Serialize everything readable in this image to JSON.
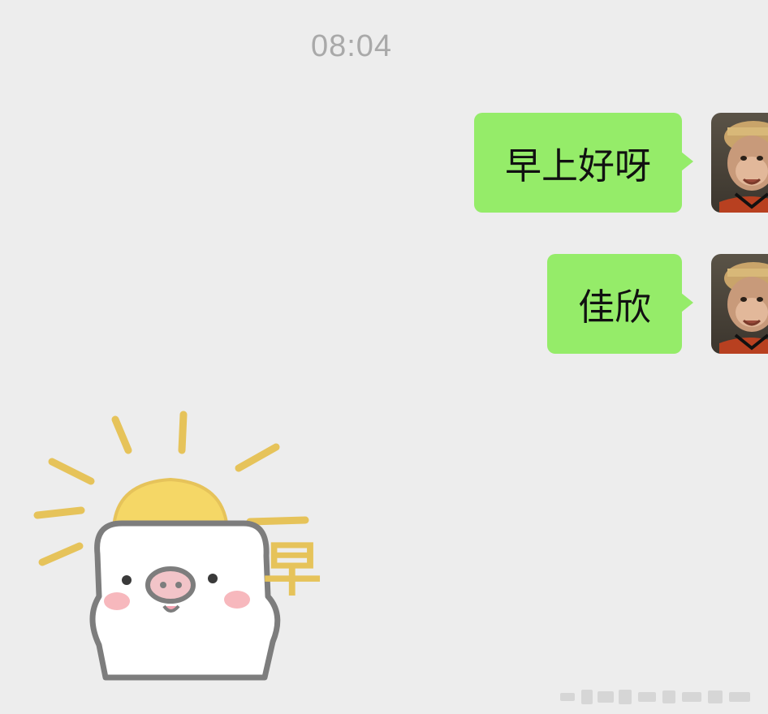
{
  "chat": {
    "timestamp": "08:04",
    "messages": [
      {
        "sender": "self",
        "type": "text",
        "text": "早上好呀"
      },
      {
        "sender": "self",
        "type": "text",
        "text": "佳欣"
      },
      {
        "sender": "other",
        "type": "sticker",
        "sticker_text": "早"
      }
    ]
  },
  "colors": {
    "background": "#ededed",
    "self_bubble": "#95ec69",
    "timestamp_text": "#a9a9a9"
  }
}
